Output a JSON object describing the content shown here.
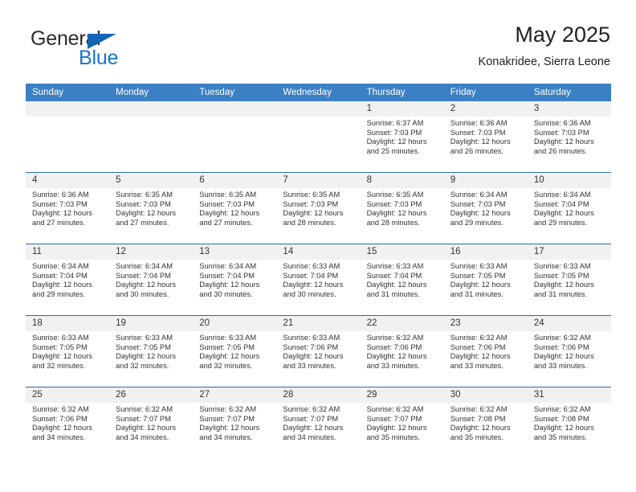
{
  "brand": {
    "word_one": "General",
    "word_two": "Blue",
    "flag_icon": "triangle-flag-icon"
  },
  "header": {
    "title": "May 2025",
    "subtitle": "Konakridee, Sierra Leone"
  },
  "colors": {
    "header_blue": "#3b80c4",
    "week_divider": "#2e6da8",
    "day_band": "#f1f1f1",
    "brand_blue": "#1574cf",
    "text": "#333333"
  },
  "weekdays": [
    "Sunday",
    "Monday",
    "Tuesday",
    "Wednesday",
    "Thursday",
    "Friday",
    "Saturday"
  ],
  "weeks": [
    [
      {
        "day": "",
        "lines": []
      },
      {
        "day": "",
        "lines": []
      },
      {
        "day": "",
        "lines": []
      },
      {
        "day": "",
        "lines": []
      },
      {
        "day": "1",
        "lines": [
          "Sunrise: 6:37 AM",
          "Sunset: 7:03 PM",
          "Daylight: 12 hours",
          "and 25 minutes."
        ]
      },
      {
        "day": "2",
        "lines": [
          "Sunrise: 6:36 AM",
          "Sunset: 7:03 PM",
          "Daylight: 12 hours",
          "and 26 minutes."
        ]
      },
      {
        "day": "3",
        "lines": [
          "Sunrise: 6:36 AM",
          "Sunset: 7:03 PM",
          "Daylight: 12 hours",
          "and 26 minutes."
        ]
      }
    ],
    [
      {
        "day": "4",
        "lines": [
          "Sunrise: 6:36 AM",
          "Sunset: 7:03 PM",
          "Daylight: 12 hours",
          "and 27 minutes."
        ]
      },
      {
        "day": "5",
        "lines": [
          "Sunrise: 6:35 AM",
          "Sunset: 7:03 PM",
          "Daylight: 12 hours",
          "and 27 minutes."
        ]
      },
      {
        "day": "6",
        "lines": [
          "Sunrise: 6:35 AM",
          "Sunset: 7:03 PM",
          "Daylight: 12 hours",
          "and 27 minutes."
        ]
      },
      {
        "day": "7",
        "lines": [
          "Sunrise: 6:35 AM",
          "Sunset: 7:03 PM",
          "Daylight: 12 hours",
          "and 28 minutes."
        ]
      },
      {
        "day": "8",
        "lines": [
          "Sunrise: 6:35 AM",
          "Sunset: 7:03 PM",
          "Daylight: 12 hours",
          "and 28 minutes."
        ]
      },
      {
        "day": "9",
        "lines": [
          "Sunrise: 6:34 AM",
          "Sunset: 7:03 PM",
          "Daylight: 12 hours",
          "and 29 minutes."
        ]
      },
      {
        "day": "10",
        "lines": [
          "Sunrise: 6:34 AM",
          "Sunset: 7:04 PM",
          "Daylight: 12 hours",
          "and 29 minutes."
        ]
      }
    ],
    [
      {
        "day": "11",
        "lines": [
          "Sunrise: 6:34 AM",
          "Sunset: 7:04 PM",
          "Daylight: 12 hours",
          "and 29 minutes."
        ]
      },
      {
        "day": "12",
        "lines": [
          "Sunrise: 6:34 AM",
          "Sunset: 7:04 PM",
          "Daylight: 12 hours",
          "and 30 minutes."
        ]
      },
      {
        "day": "13",
        "lines": [
          "Sunrise: 6:34 AM",
          "Sunset: 7:04 PM",
          "Daylight: 12 hours",
          "and 30 minutes."
        ]
      },
      {
        "day": "14",
        "lines": [
          "Sunrise: 6:33 AM",
          "Sunset: 7:04 PM",
          "Daylight: 12 hours",
          "and 30 minutes."
        ]
      },
      {
        "day": "15",
        "lines": [
          "Sunrise: 6:33 AM",
          "Sunset: 7:04 PM",
          "Daylight: 12 hours",
          "and 31 minutes."
        ]
      },
      {
        "day": "16",
        "lines": [
          "Sunrise: 6:33 AM",
          "Sunset: 7:05 PM",
          "Daylight: 12 hours",
          "and 31 minutes."
        ]
      },
      {
        "day": "17",
        "lines": [
          "Sunrise: 6:33 AM",
          "Sunset: 7:05 PM",
          "Daylight: 12 hours",
          "and 31 minutes."
        ]
      }
    ],
    [
      {
        "day": "18",
        "lines": [
          "Sunrise: 6:33 AM",
          "Sunset: 7:05 PM",
          "Daylight: 12 hours",
          "and 32 minutes."
        ]
      },
      {
        "day": "19",
        "lines": [
          "Sunrise: 6:33 AM",
          "Sunset: 7:05 PM",
          "Daylight: 12 hours",
          "and 32 minutes."
        ]
      },
      {
        "day": "20",
        "lines": [
          "Sunrise: 6:33 AM",
          "Sunset: 7:05 PM",
          "Daylight: 12 hours",
          "and 32 minutes."
        ]
      },
      {
        "day": "21",
        "lines": [
          "Sunrise: 6:33 AM",
          "Sunset: 7:06 PM",
          "Daylight: 12 hours",
          "and 33 minutes."
        ]
      },
      {
        "day": "22",
        "lines": [
          "Sunrise: 6:32 AM",
          "Sunset: 7:06 PM",
          "Daylight: 12 hours",
          "and 33 minutes."
        ]
      },
      {
        "day": "23",
        "lines": [
          "Sunrise: 6:32 AM",
          "Sunset: 7:06 PM",
          "Daylight: 12 hours",
          "and 33 minutes."
        ]
      },
      {
        "day": "24",
        "lines": [
          "Sunrise: 6:32 AM",
          "Sunset: 7:06 PM",
          "Daylight: 12 hours",
          "and 33 minutes."
        ]
      }
    ],
    [
      {
        "day": "25",
        "lines": [
          "Sunrise: 6:32 AM",
          "Sunset: 7:06 PM",
          "Daylight: 12 hours",
          "and 34 minutes."
        ]
      },
      {
        "day": "26",
        "lines": [
          "Sunrise: 6:32 AM",
          "Sunset: 7:07 PM",
          "Daylight: 12 hours",
          "and 34 minutes."
        ]
      },
      {
        "day": "27",
        "lines": [
          "Sunrise: 6:32 AM",
          "Sunset: 7:07 PM",
          "Daylight: 12 hours",
          "and 34 minutes."
        ]
      },
      {
        "day": "28",
        "lines": [
          "Sunrise: 6:32 AM",
          "Sunset: 7:07 PM",
          "Daylight: 12 hours",
          "and 34 minutes."
        ]
      },
      {
        "day": "29",
        "lines": [
          "Sunrise: 6:32 AM",
          "Sunset: 7:07 PM",
          "Daylight: 12 hours",
          "and 35 minutes."
        ]
      },
      {
        "day": "30",
        "lines": [
          "Sunrise: 6:32 AM",
          "Sunset: 7:08 PM",
          "Daylight: 12 hours",
          "and 35 minutes."
        ]
      },
      {
        "day": "31",
        "lines": [
          "Sunrise: 6:32 AM",
          "Sunset: 7:08 PM",
          "Daylight: 12 hours",
          "and 35 minutes."
        ]
      }
    ]
  ]
}
